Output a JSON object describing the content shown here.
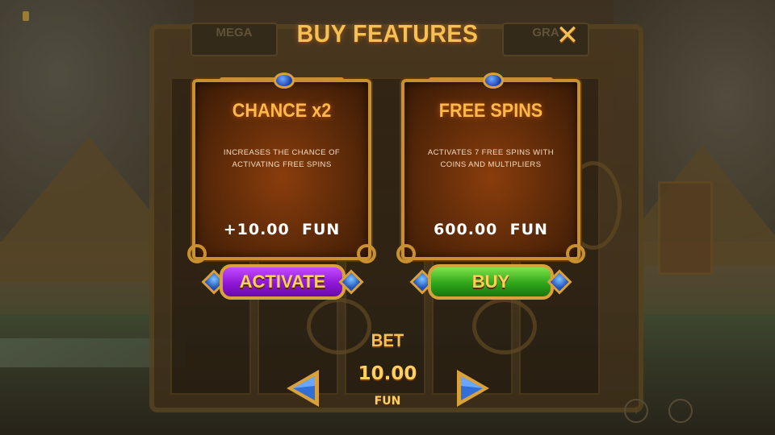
{
  "dialog": {
    "title": "BUY FEATURES",
    "close_icon": "close-icon"
  },
  "background": {
    "top_left_plate": "MEGA",
    "top_right_plate": "GRA"
  },
  "features": [
    {
      "title": "CHANCE x2",
      "description": "INCREASES THE CHANCE OF ACTIVATING FREE SPINS",
      "price": "+10.00  FUN",
      "button_label": "ACTIVATE",
      "button_color": "#9b1fe0"
    },
    {
      "title": "FREE SPINS",
      "description": "ACTIVATES 7 FREE SPINS WITH COINS AND MULTIPLIERS",
      "price": "600.00  FUN",
      "button_label": "BUY",
      "button_color": "#34b01e"
    }
  ],
  "bet": {
    "label": "BET",
    "value": "10.00",
    "unit": "FUN",
    "decrease_icon": "arrow-left-icon",
    "increase_icon": "arrow-right-icon"
  },
  "colors": {
    "title_gold": "#f5c155",
    "frame_gold": "#c9902f",
    "gem_blue": "#1e4fb8"
  }
}
